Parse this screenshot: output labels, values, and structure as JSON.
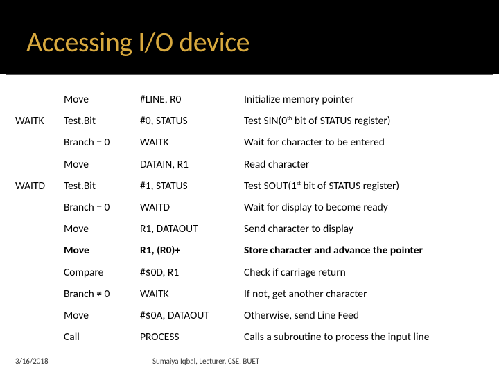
{
  "title": "Accessing I/O device",
  "rows": [
    {
      "label": "",
      "op": "Move",
      "args": "#LINE, R0",
      "comment": "Initialize memory pointer",
      "bold": false
    },
    {
      "label": "WAITK",
      "op": "Test.Bit",
      "args": "#0, STATUS",
      "comment": "Test SIN(0<sup>th</sup> bit of STATUS register)",
      "bold": false
    },
    {
      "label": "",
      "op": "Branch = 0",
      "args": "WAITK",
      "comment": "Wait for character to be entered",
      "bold": false
    },
    {
      "label": "",
      "op": "Move",
      "args": "DATAIN, R1",
      "comment": "Read character",
      "bold": false
    },
    {
      "label": "WAITD",
      "op": "Test.Bit",
      "args": "#1, STATUS",
      "comment": "Test SOUT(1<sup>st</sup> bit of STATUS register)",
      "bold": false
    },
    {
      "label": "",
      "op": "Branch = 0",
      "args": "WAITD",
      "comment": "Wait for display to become ready",
      "bold": false
    },
    {
      "label": "",
      "op": "Move",
      "args": "R1, DATAOUT",
      "comment": "Send character to display",
      "bold": false
    },
    {
      "label": "",
      "op": "Move",
      "args": "R1, (R0)+",
      "comment": "Store character and advance the pointer",
      "bold": true
    },
    {
      "label": "",
      "op": "Compare",
      "args": "#$0D, R1",
      "comment": "Check if carriage return",
      "bold": false
    },
    {
      "label": "",
      "op": "Branch ≠ 0",
      "args": "WAITK",
      "comment": "If not, get another character",
      "bold": false
    },
    {
      "label": "",
      "op": "Move",
      "args": "#$0A, DATAOUT",
      "comment": "Otherwise, send Line Feed",
      "bold": false
    },
    {
      "label": "",
      "op": "Call",
      "args": "PROCESS",
      "comment": "Calls a subroutine to process the input line",
      "bold": false
    }
  ],
  "footer": {
    "date": "3/16/2018",
    "credit": "Sumaiya Iqbal, Lecturer, CSE, BUET"
  }
}
